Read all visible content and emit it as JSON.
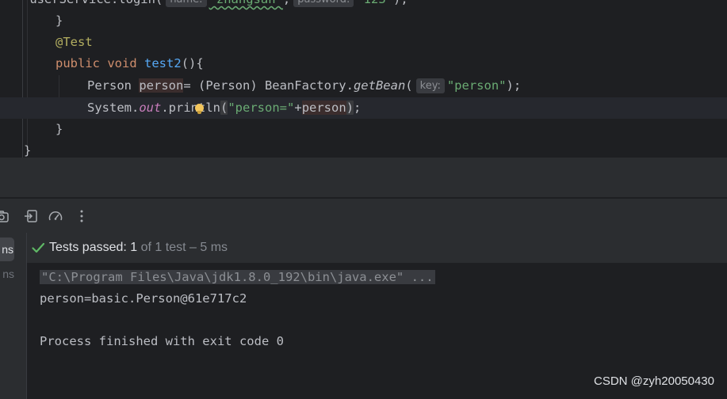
{
  "editor": {
    "line0": {
      "prefix": "    userService.login(",
      "hint_name": "name:",
      "arg1": "\"zhangsan\"",
      "comma": ",",
      "hint_password": "password:",
      "arg2": "\"123\"",
      "suffix": ");"
    },
    "line1": {
      "text": "}"
    },
    "line2": {
      "annotation": "@Test"
    },
    "line3": {
      "kw1": "public",
      "kw2": "void",
      "method": "test2",
      "rest": "(){"
    },
    "line4": {
      "type": "Person ",
      "var": "person",
      "mid": "= (Person) BeanFactory.",
      "call": "getBean",
      "open": "(",
      "hint_key": "key:",
      "arg": "\"person\"",
      "close": ");"
    },
    "line5": {
      "cls": "System.",
      "field": "out",
      "dot": ".",
      "method": "println",
      "open": "(",
      "str": "\"person=\"",
      "plus": "+",
      "var": "person",
      "close": ")",
      "end": ";"
    },
    "line6": {
      "text": "}"
    },
    "line7": {
      "text": "}"
    }
  },
  "run_panel": {
    "tab_active": "ns",
    "tab_other": "ns",
    "status": {
      "label": "Tests passed:",
      "passed": "1",
      "of_total": "of 1 test",
      "duration": "– 5 ms"
    }
  },
  "console": {
    "command": "\"C:\\Program Files\\Java\\jdk1.8.0_192\\bin\\java.exe\" ...",
    "output": "person=basic.Person@61e717c2",
    "exit": "Process finished with exit code 0"
  },
  "watermark": "CSDN @zyh20050430",
  "colors": {
    "editor_bg": "#1e1f22",
    "panel_bg": "#2b2d30",
    "keyword": "#cf8e6d",
    "string": "#6aab73",
    "method": "#56a8f5",
    "success": "#5fb865"
  },
  "icons": [
    "camera-icon",
    "export-icon",
    "coverage-gauge-icon",
    "more-vertical-icon",
    "check-icon",
    "lightbulb-icon"
  ]
}
